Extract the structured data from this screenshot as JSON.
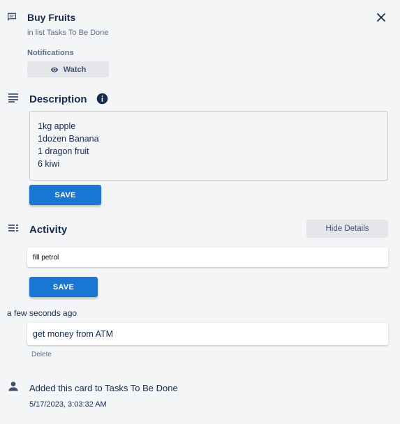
{
  "card": {
    "title": "Buy Fruits",
    "list_text": "in list Tasks To Be Done",
    "close_icon": "close-icon",
    "card_icon": "card-icon"
  },
  "notifications": {
    "label": "Notifications",
    "watch_label": "Watch",
    "watch_icon": "eye-icon"
  },
  "description": {
    "title": "Description",
    "icon": "description-icon",
    "info_icon": "info-icon",
    "lines": [
      "1kg apple",
      "1dozen Banana",
      "1 dragon fruit",
      "6 kiwi"
    ],
    "save_label": "SAVE"
  },
  "activity": {
    "title": "Activity",
    "icon": "activity-icon",
    "hide_details_label": "Hide Details",
    "comment_input_value": "fill petrol",
    "save_label": "SAVE",
    "comments": [
      {
        "time": "a few seconds ago",
        "text": "get money from ATM",
        "delete_label": "Delete"
      }
    ],
    "events": [
      {
        "icon": "person-icon",
        "text": "Added this card to Tasks To Be Done",
        "timestamp": "5/17/2023, 3:03:32 AM"
      }
    ]
  },
  "colors": {
    "primary": "#1976d2",
    "background": "#f4f5f7",
    "text": "#172b4d"
  }
}
